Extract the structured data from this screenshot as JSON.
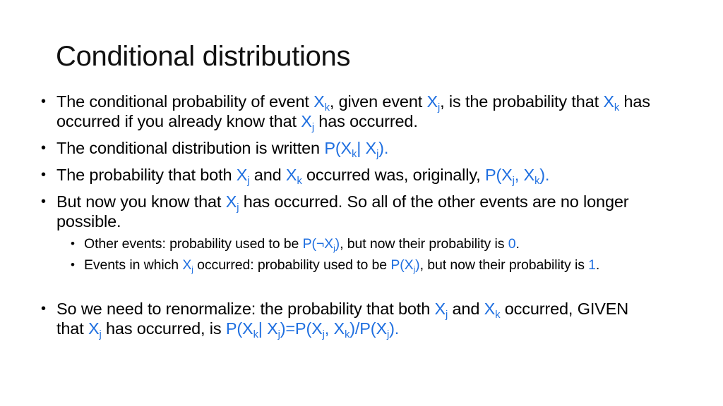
{
  "slide": {
    "title": "Conditional distributions",
    "accent_color": "#1f6fe0",
    "bullets": [
      {
        "level": 1,
        "segments": [
          {
            "t": "The conditional probability of event "
          },
          {
            "t": "X",
            "m": true,
            "sub": "k"
          },
          {
            "t": ", given event "
          },
          {
            "t": "X",
            "m": true,
            "sub": "j"
          },
          {
            "t": ", is the probability that "
          },
          {
            "t": "X",
            "m": true,
            "sub": "k"
          },
          {
            "t": " has occurred if you already know that "
          },
          {
            "t": "X",
            "m": true,
            "sub": "j"
          },
          {
            "t": " has occurred."
          }
        ]
      },
      {
        "level": 1,
        "segments": [
          {
            "t": "The conditional distribution is written "
          },
          {
            "t": "P(X",
            "m": true,
            "sub": "k"
          },
          {
            "t": "| X",
            "m": true,
            "sub": "j"
          },
          {
            "t": ").",
            "m": true
          }
        ]
      },
      {
        "level": 1,
        "segments": [
          {
            "t": "The probability that both "
          },
          {
            "t": "X",
            "m": true,
            "sub": "j"
          },
          {
            "t": " and "
          },
          {
            "t": "X",
            "m": true,
            "sub": "k"
          },
          {
            "t": " occurred was, originally, "
          },
          {
            "t": "P(X",
            "m": true,
            "sub": "j"
          },
          {
            "t": ", X",
            "m": true,
            "sub": "k"
          },
          {
            "t": ").",
            "m": true
          }
        ]
      },
      {
        "level": 1,
        "segments": [
          {
            "t": "But now you know that "
          },
          {
            "t": "X",
            "m": true,
            "sub": "j"
          },
          {
            "t": " has occurred.  So all of the other events are no longer possible."
          }
        ]
      },
      {
        "level": 2,
        "segments": [
          {
            "t": "Other events: probability used to be "
          },
          {
            "t": "P(¬X",
            "m": true,
            "sub": "j"
          },
          {
            "t": ")",
            "m": true
          },
          {
            "t": ", but now their probability is "
          },
          {
            "t": "0",
            "m": true
          },
          {
            "t": "."
          }
        ]
      },
      {
        "level": 2,
        "segments": [
          {
            "t": "Events in which "
          },
          {
            "t": "X",
            "m": true,
            "sub": "j"
          },
          {
            "t": " occurred: probability used to be "
          },
          {
            "t": "P(X",
            "m": true,
            "sub": "j"
          },
          {
            "t": ")",
            "m": true
          },
          {
            "t": ", but now their probability is "
          },
          {
            "t": "1",
            "m": true
          },
          {
            "t": "."
          }
        ]
      },
      {
        "level": 1,
        "segments": [
          {
            "t": "So we need to renormalize: the probability that both "
          },
          {
            "t": "X",
            "m": true,
            "sub": "j"
          },
          {
            "t": " and "
          },
          {
            "t": "X",
            "m": true,
            "sub": "k"
          },
          {
            "t": " occurred, GIVEN that "
          },
          {
            "t": "X",
            "m": true,
            "sub": "j"
          },
          {
            "t": " has occurred, is "
          },
          {
            "t": "P(X",
            "m": true,
            "sub": "k"
          },
          {
            "t": "| X",
            "m": true,
            "sub": "j"
          },
          {
            "t": ")=P(X",
            "m": true,
            "sub": "j"
          },
          {
            "t": ", X",
            "m": true,
            "sub": "k"
          },
          {
            "t": ")/P(X",
            "m": true,
            "sub": "j"
          },
          {
            "t": ").",
            "m": true
          }
        ]
      }
    ]
  }
}
